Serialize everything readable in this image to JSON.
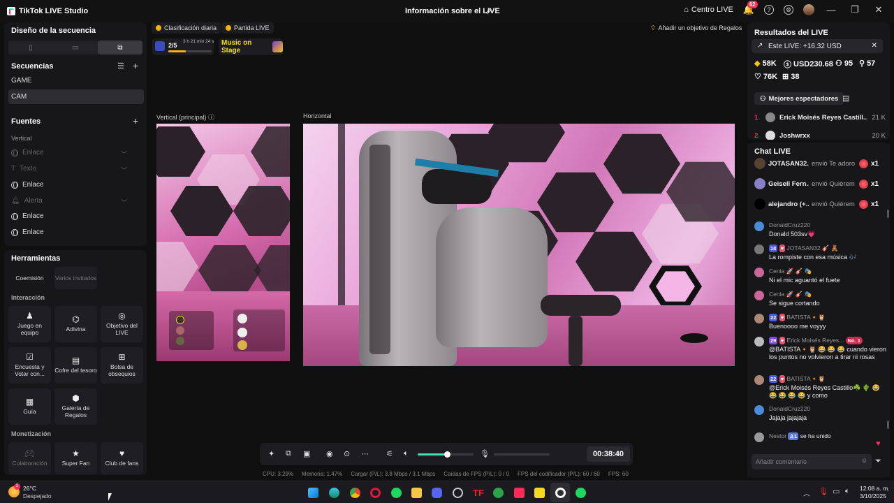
{
  "app": {
    "title": "TikTok LIVE Studio",
    "center_title": "Información sobre el LIVE"
  },
  "header": {
    "centro": "Centro LIVE",
    "notif_count": "62"
  },
  "left": {
    "layout_title": "Diseño de la secuencia",
    "sequences_title": "Secuencias",
    "sequences": [
      "GAME",
      "CAM"
    ],
    "sources_title": "Fuentes",
    "sources_group": "Vertical",
    "sources": [
      {
        "label": "Enlace",
        "dim": true
      },
      {
        "label": "Texto",
        "dim": true
      },
      {
        "label": "Enlace",
        "dim": false
      },
      {
        "label": "Alerta",
        "dim": true
      },
      {
        "label": "Enlace",
        "dim": false
      },
      {
        "label": "Enlace",
        "dim": false
      }
    ]
  },
  "tools": {
    "title": "Herramientas",
    "top": [
      "Coemisión",
      "Varios invitados"
    ],
    "interaction_title": "Interacción",
    "interaction": [
      "Juego en equipo",
      "Adivina",
      "Objetivo del LIVE",
      "Encuesta y Votar con...",
      "Cofre del tesoro",
      "Bolsa de obsequios",
      "Guía",
      "Galería de Regalos"
    ],
    "monetization_title": "Monetización",
    "monetization": [
      "Colaboración",
      "Super Fan",
      "Club de fans"
    ]
  },
  "top_chips": {
    "ranking": "Clasificación diaria",
    "match": "Partida LIVE",
    "goal": "Añadir un objetivo de Regalos",
    "progress": "2/5",
    "progress_fraction": 0.4,
    "countdown": "3 h 21 min 24 s",
    "music": "Music on Stage"
  },
  "previews": {
    "vertical": "Vertical (principal)",
    "horizontal": "Horizontal"
  },
  "controls": {
    "timer": "00:38:40",
    "volume_fraction": 0.52
  },
  "stats": [
    "CPU: 3.29%",
    "Memoria: 1.47%",
    "Cargar (P/L): 3.8 Mbps / 3.1 Mbps",
    "Caídas de FPS (P/L): 0 / 0",
    "FPS del codificador (P/L): 60 / 60",
    "FPS: 60"
  ],
  "results": {
    "title": "Resultados del LIVE",
    "este": "Este LIVE: +16.32 USD",
    "diamonds": "58K",
    "usd": "USD230.68",
    "viewers": "95",
    "followers": "57",
    "likes": "76K",
    "gifters": "38",
    "best_viewers": "Mejores espectadores",
    "ranking": [
      {
        "rank": "1",
        "name": "Erick Moisés Reyes Castill...",
        "score": "21 K"
      },
      {
        "rank": "2",
        "name": "Joshwrxx",
        "score": "20 K"
      }
    ]
  },
  "chat": {
    "title": "Chat LIVE",
    "gifts": [
      {
        "name": "JOTASAN32...",
        "text": "envió Te adoro",
        "count": "x1"
      },
      {
        "name": "Geisell Fern...",
        "text": "envió Quiérem",
        "count": "x1"
      },
      {
        "name": "alejandro (+...",
        "text": "envió Quiérem",
        "count": "x1"
      }
    ],
    "messages": [
      {
        "user": "DonaldCruz220",
        "badge": "",
        "text": "Donald 503sv💗"
      },
      {
        "user": "JOTASAN32 🎸 🧸",
        "badge": "18",
        "text": "La rompiste con esa música 🎶"
      },
      {
        "user": "Cenia 🚀 🎸 🎭",
        "badge": "",
        "text": "Ni el mic aguantó el fuete"
      },
      {
        "user": "Cenia 🚀 🎸 🎭",
        "badge": "",
        "text": "Se sigue cortando"
      },
      {
        "user": "BATISTA🔸🦉",
        "badge": "22",
        "text": "Buenoooo me voyyy"
      },
      {
        "user": "Erick Moisés Reyes...",
        "badge": "29",
        "text": "@BATISTA🔸🦉 😂 😂 😂 cuando vieron los puntos no volvieron a tirar ni rosas"
      },
      {
        "user": "BATISTA🔸🦉",
        "badge": "22",
        "text": "@Erick Moisés Reyes Castillo☘️ 🌵 😂 😂 😂 😂 😂 y como"
      },
      {
        "user": "DonaldCruz220",
        "badge": "",
        "text": "Jajaja jajajaja"
      },
      {
        "user": "Nestor",
        "badge": "1",
        "text": "se ha unido"
      }
    ],
    "no1": "No. 1",
    "placeholder": "Añadir comentario"
  },
  "taskbar": {
    "temp": "26°C",
    "weather": "Despejado",
    "time": "12:08 a. m.",
    "date": "3/10/2025"
  }
}
